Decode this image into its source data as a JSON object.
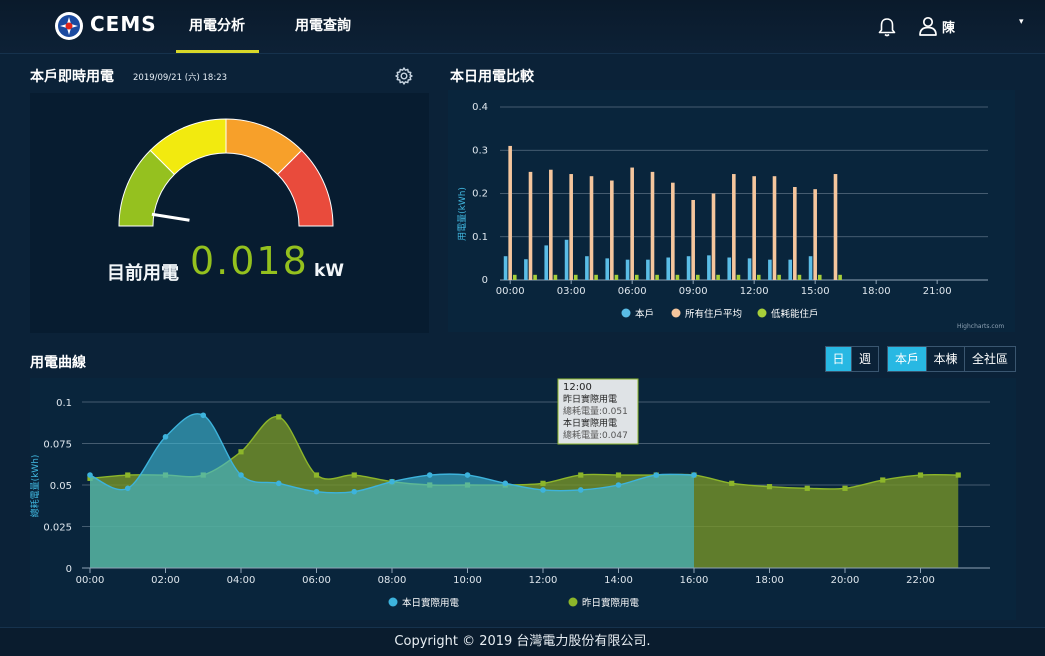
{
  "header": {
    "brand": "CEMS",
    "nav": [
      {
        "label": "用電分析",
        "active": true
      },
      {
        "label": "用電查詢",
        "active": false
      }
    ],
    "user_name": "陳",
    "caret": "▾"
  },
  "realtime": {
    "title": "本戶即時用電",
    "timestamp": "2019/09/21 (六) 18:23",
    "label": "目前用電",
    "value": "0.018",
    "unit": "kW",
    "gauge_colors": [
      "#95c11f",
      "#f2ea0f",
      "#f7a02a",
      "#e94b3c"
    ],
    "level": 0.05
  },
  "compare": {
    "title": "本日用電比較",
    "credit": "Highcharts.com"
  },
  "curve": {
    "title": "用電曲線",
    "period_buttons": [
      {
        "label": "日",
        "active": true
      },
      {
        "label": "週",
        "active": false
      }
    ],
    "scope_buttons": [
      {
        "label": "本戶",
        "active": true
      },
      {
        "label": "本棟",
        "active": false
      },
      {
        "label": "全社區",
        "active": false
      }
    ],
    "tooltip": {
      "time": "12:00",
      "lines": [
        "昨日實際用電",
        "總耗電量:0.051",
        "本日實際用電",
        "總耗電量:0.047"
      ]
    }
  },
  "footer": {
    "copyright": "Copyright © 2019 台灣電力股份有限公司."
  },
  "chart_data": [
    {
      "type": "bar",
      "title": "本日用電比較",
      "ylabel": "用電量(kWh)",
      "ylim": [
        0,
        0.4
      ],
      "yticks": [
        "0",
        "0.1",
        "0.2",
        "0.3",
        "0.4"
      ],
      "xticks": [
        "00:00",
        "03:00",
        "06:00",
        "09:00",
        "12:00",
        "15:00",
        "18:00",
        "21:00"
      ],
      "grid": true,
      "legend": "bottom",
      "categories": [
        "00",
        "01",
        "02",
        "03",
        "04",
        "05",
        "06",
        "07",
        "08",
        "09",
        "10",
        "11",
        "12",
        "13",
        "14",
        "15",
        "16",
        "17",
        "18",
        "19",
        "20",
        "21",
        "22",
        "23"
      ],
      "series": [
        {
          "name": "本戶",
          "color": "#5bbde6",
          "values": [
            0.055,
            0.048,
            0.08,
            0.093,
            0.055,
            0.05,
            0.047,
            0.047,
            0.052,
            0.055,
            0.057,
            0.052,
            0.05,
            0.047,
            0.047,
            0.055,
            null,
            null,
            null,
            null,
            null,
            null,
            null,
            null
          ]
        },
        {
          "name": "所有住戶平均",
          "color": "#f5c69d",
          "values": [
            0.31,
            0.25,
            0.255,
            0.245,
            0.24,
            0.23,
            0.26,
            0.25,
            0.225,
            0.185,
            0.2,
            0.245,
            0.24,
            0.24,
            0.215,
            0.21,
            0.245,
            null,
            null,
            null,
            null,
            null,
            null,
            null
          ]
        },
        {
          "name": "低耗能住戶",
          "color": "#a7cf3a",
          "values": [
            0.012,
            0.012,
            0.012,
            0.012,
            0.012,
            0.012,
            0.012,
            0.012,
            0.012,
            0.012,
            0.012,
            0.012,
            0.012,
            0.012,
            0.012,
            0.012,
            0.012,
            null,
            null,
            null,
            null,
            null,
            null,
            null
          ]
        }
      ]
    },
    {
      "type": "area",
      "title": "用電曲線",
      "ylabel": "總耗電量(kWh)",
      "ylim": [
        0,
        0.1
      ],
      "yticks": [
        "0",
        "0.025",
        "0.05",
        "0.075",
        "0.1"
      ],
      "xticks": [
        "00:00",
        "02:00",
        "04:00",
        "06:00",
        "08:00",
        "10:00",
        "12:00",
        "14:00",
        "16:00",
        "18:00",
        "20:00",
        "22:00"
      ],
      "grid": true,
      "legend": "bottom",
      "x": [
        0,
        1,
        2,
        3,
        4,
        5,
        6,
        7,
        8,
        9,
        10,
        11,
        12,
        13,
        14,
        15,
        16,
        17,
        18,
        19,
        20,
        21,
        22,
        23
      ],
      "series": [
        {
          "name": "昨日實際用電",
          "color": "#8db62a",
          "values": [
            0.054,
            0.056,
            0.056,
            0.056,
            0.07,
            0.091,
            0.056,
            0.056,
            0.052,
            0.05,
            0.05,
            0.05,
            0.051,
            0.056,
            0.056,
            0.056,
            0.056,
            0.051,
            0.049,
            0.048,
            0.048,
            0.053,
            0.056,
            0.056
          ]
        },
        {
          "name": "本日實際用電",
          "color": "#3db3dc",
          "values": [
            0.056,
            0.048,
            0.079,
            0.092,
            0.056,
            0.051,
            0.046,
            0.046,
            0.052,
            0.056,
            0.056,
            0.051,
            0.047,
            0.047,
            0.05,
            0.056,
            0.056,
            null,
            null,
            null,
            null,
            null,
            null,
            null
          ]
        }
      ]
    }
  ]
}
